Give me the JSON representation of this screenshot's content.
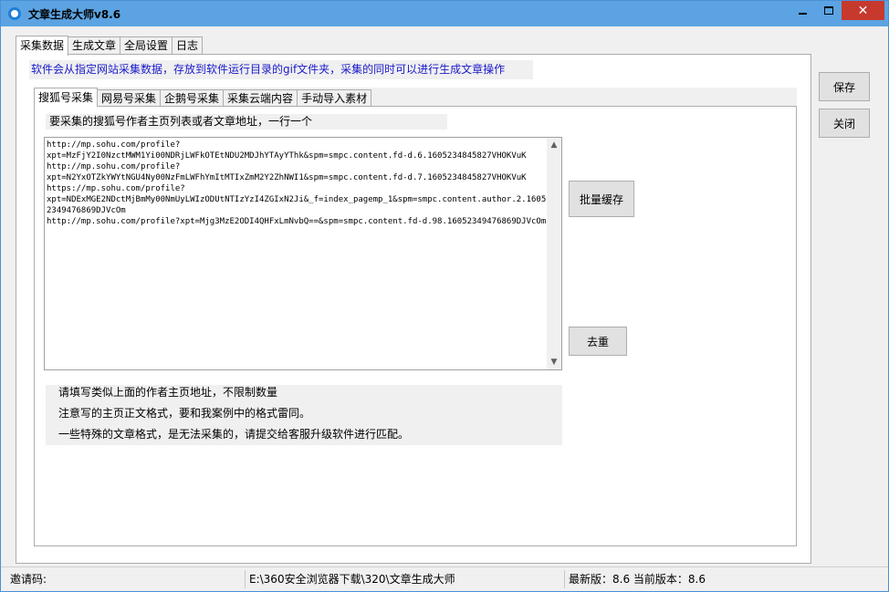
{
  "window": {
    "title": "文章生成大师v8.6",
    "close_glyph": "✕"
  },
  "outer_tabs": [
    {
      "label": "采集数据"
    },
    {
      "label": "生成文章"
    },
    {
      "label": "全局设置"
    },
    {
      "label": "日志"
    }
  ],
  "info_text": "软件会从指定网站采集数据，存放到软件运行目录的gif文件夹，采集的同时可以进行生成文章操作",
  "inner_tabs": [
    {
      "label": "搜狐号采集"
    },
    {
      "label": "网易号采集"
    },
    {
      "label": "企鹅号采集"
    },
    {
      "label": "采集云端内容"
    },
    {
      "label": "手动导入素材"
    }
  ],
  "url_label": "要采集的搜狐号作者主页列表或者文章地址，一行一个",
  "url_text": "http://mp.sohu.com/profile?\nxpt=MzFjY2I0NzctMWM1Yi00NDRjLWFkOTEtNDU2MDJhYTAyYThk&spm=smpc.content.fd-d.6.1605234845827VHOKVuK\nhttp://mp.sohu.com/profile?\nxpt=N2YxOTZkYWYtNGU4Ny00NzFmLWFhYmItMTIxZmM2Y2ZhNWI1&spm=smpc.content.fd-d.7.1605234845827VHOKVuK\nhttps://mp.sohu.com/profile?\nxpt=NDExMGE2NDctMjBmMy00NmUyLWIzODUtNTIzYzI4ZGIxN2Ji&_f=index_pagemp_1&spm=smpc.content.author.2.16052349476869DJVcOm\nhttp://mp.sohu.com/profile?xpt=Mjg3MzE2ODI4QHFxLmNvbQ==&spm=smpc.content.fd-d.98.16052349476869DJVcOm",
  "buttons": {
    "batch_save": "批量缓存",
    "dedupe": "去重",
    "save": "保存",
    "close": "关闭"
  },
  "notes": [
    "请填写类似上面的作者主页地址，不限制数量",
    "注意写的主页正文格式，要和我案例中的格式雷同。",
    "一些特殊的文章格式，是无法采集的，请提交给客服升级软件进行匹配。"
  ],
  "status": {
    "invite": "邀请码:",
    "path": "E:\\360安全浏览器下载\\320\\文章生成大师",
    "version": "最新版：8.6 当前版本：8.6"
  },
  "colors": {
    "titlebar": "#5ba3e2",
    "close_button": "#c7392d",
    "info_text": "#1a1acc"
  }
}
